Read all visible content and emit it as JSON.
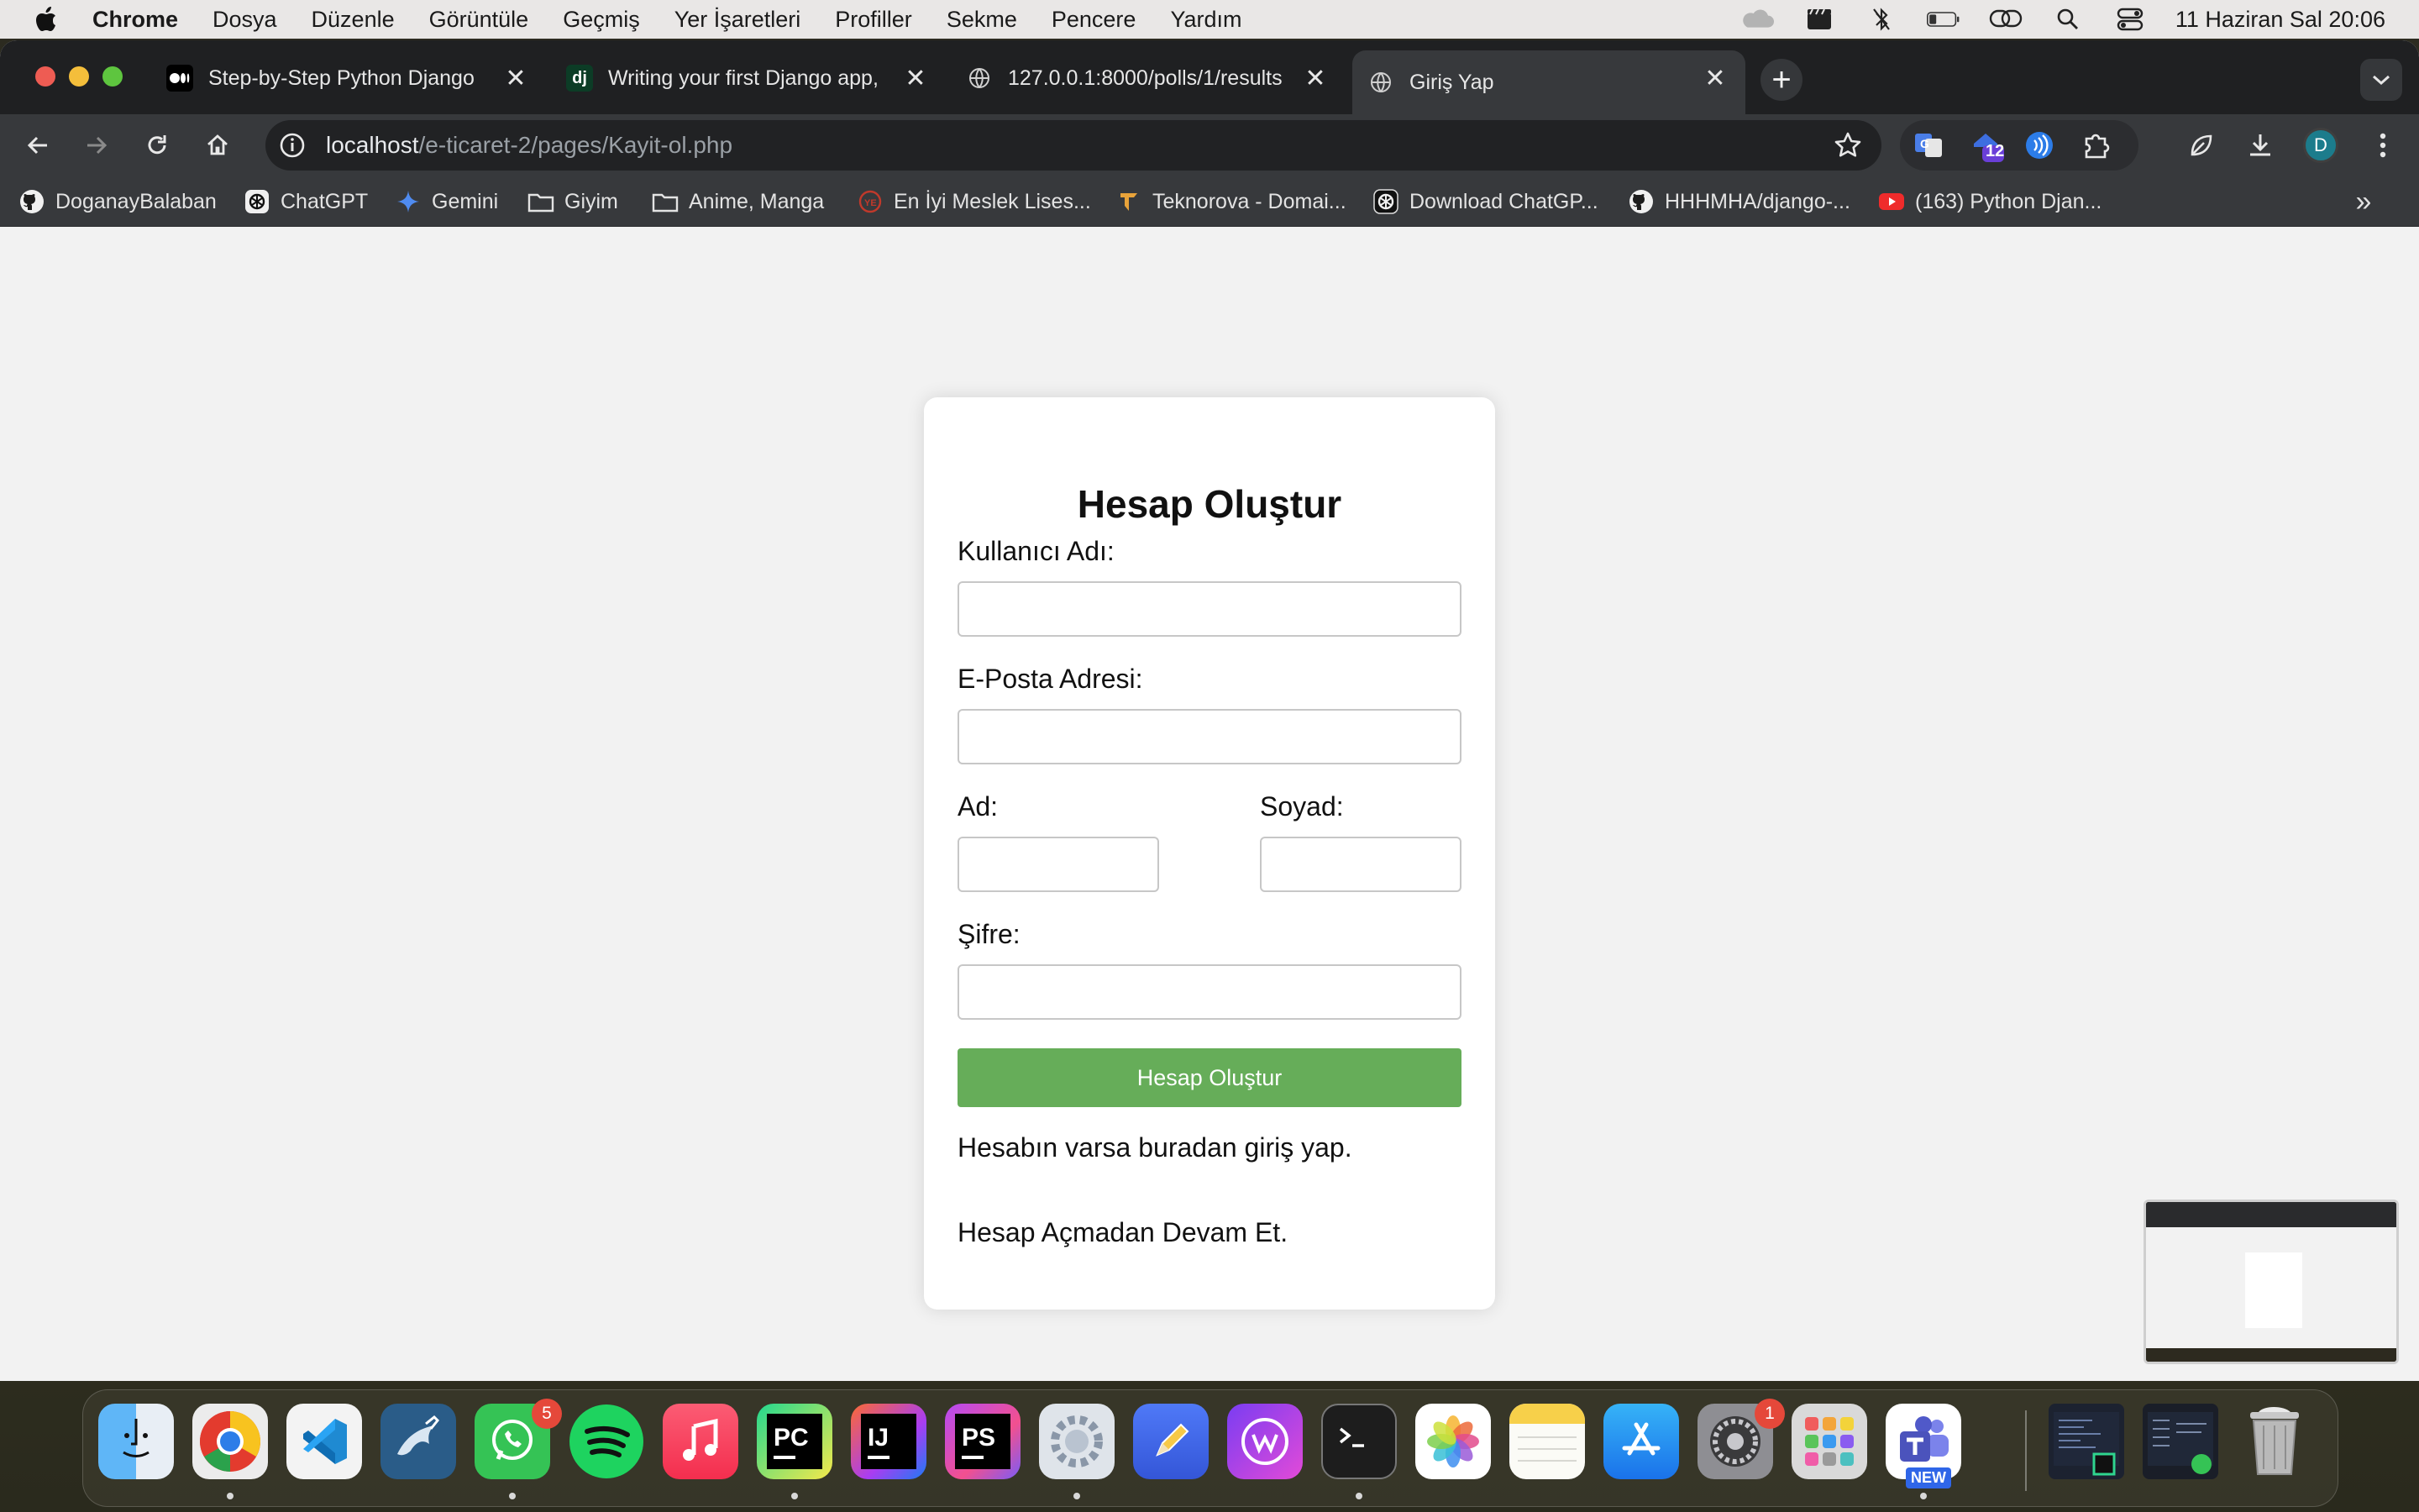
{
  "menubar": {
    "app_name": "Chrome",
    "items": [
      "Dosya",
      "Düzenle",
      "Görüntüle",
      "Geçmiş",
      "Yer İşaretleri",
      "Profiller",
      "Sekme",
      "Pencere",
      "Yardım"
    ],
    "clock": "11 Haziran Sal  20:06"
  },
  "tabs": [
    {
      "label": "Step-by-Step Python Django",
      "favicon": "medium-icon"
    },
    {
      "label": "Writing your first Django app,",
      "favicon_text": "dj"
    },
    {
      "label": "127.0.0.1:8000/polls/1/results",
      "favicon": "globe-icon"
    },
    {
      "label": "Giriş Yap",
      "favicon": "globe-icon",
      "active": true
    }
  ],
  "address_bar": {
    "host": "localhost",
    "path": "/e-ticaret-2/pages/Kayit-ol.php"
  },
  "extensions": {
    "badge_count": "12"
  },
  "profile": {
    "initial": "D"
  },
  "bookmarks": [
    {
      "label": "DoganayBalaban",
      "icon": "github-icon"
    },
    {
      "label": "ChatGPT",
      "icon": "chatgpt-icon"
    },
    {
      "label": "Gemini",
      "icon": "gemini-icon"
    },
    {
      "label": "Giyim",
      "icon": "folder-icon"
    },
    {
      "label": "Anime, Manga",
      "icon": "folder-icon"
    },
    {
      "label": "En İyi Meslek Lises...",
      "icon": "site-icon"
    },
    {
      "label": "Teknorova - Domai...",
      "icon": "teknorova-icon"
    },
    {
      "label": "Download ChatGP...",
      "icon": "chatgpt-icon"
    },
    {
      "label": "HHHMHA/django-...",
      "icon": "github-icon"
    },
    {
      "label": "(163) Python Djan...",
      "icon": "youtube-icon"
    }
  ],
  "form": {
    "title": "Hesap Oluştur",
    "username_label": "Kullanıcı Adı:",
    "username_value": "",
    "email_label": "E-Posta Adresi:",
    "email_value": "",
    "firstname_label": "Ad:",
    "firstname_value": "",
    "lastname_label": "Soyad:",
    "lastname_value": "",
    "password_label": "Şifre:",
    "password_value": "",
    "submit_label": "Hesap Oluştur",
    "login_link": "Hesabın varsa buradan giriş yap.",
    "guest_link": "Hesap Açmadan Devam Et."
  },
  "dock": {
    "apps": [
      "Finder",
      "Chrome",
      "VS Code",
      "MySQL Workbench",
      "WhatsApp",
      "Spotify",
      "Music",
      "PyCharm",
      "IntelliJ IDEA",
      "PhpStorm",
      "Compressor",
      "Pencil",
      "Wondershare",
      "Terminal",
      "Photos",
      "Notes",
      "App Store",
      "System Settings",
      "Launchpad",
      "Teams"
    ],
    "whatsapp_badge": "5",
    "settings_badge": "1",
    "teams_tag": "NEW",
    "pycharm_label": "PC",
    "intellij_label": "IJ",
    "phpstorm_label": "PS"
  },
  "colors": {
    "submit_bg": "#66ad59",
    "menubar_bg": "#e9e7e6",
    "tabstrip_bg": "#1f2022",
    "toolbar_bg": "#37393c",
    "page_bg": "#f2f2f2"
  }
}
